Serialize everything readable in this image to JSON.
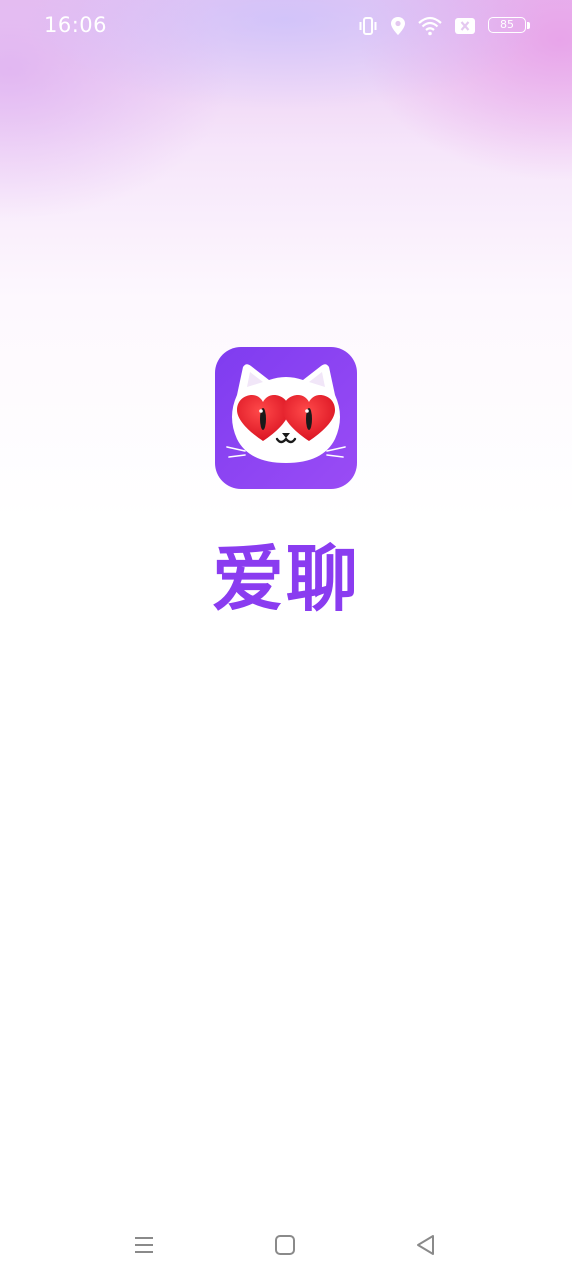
{
  "status_bar": {
    "time": "16:06",
    "battery_level": "85",
    "icons": [
      "vibrate-icon",
      "location-icon",
      "wifi-icon",
      "no-sim-icon",
      "battery-icon"
    ]
  },
  "splash": {
    "app_name": "爱聊",
    "logo": "cat-heart-eyes-logo",
    "colors": {
      "brand_purple": "#8a3cf0",
      "logo_bg": "#8b44f2",
      "heart_red": "#e8222d"
    }
  },
  "nav_bar": {
    "buttons": [
      "menu-icon",
      "home-icon",
      "back-icon"
    ]
  }
}
